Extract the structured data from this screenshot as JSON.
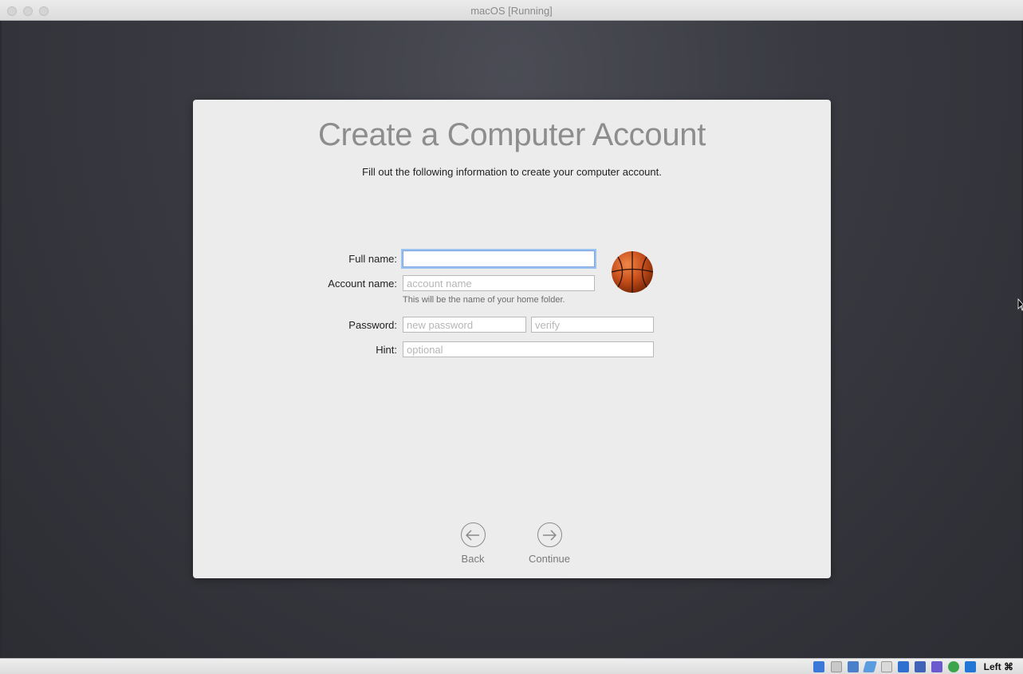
{
  "window": {
    "title": "macOS [Running]"
  },
  "setup": {
    "heading": "Create a Computer Account",
    "subheading": "Fill out the following information to create your computer account.",
    "full_name": {
      "label": "Full name:",
      "value": "",
      "placeholder": ""
    },
    "account_name": {
      "label": "Account name:",
      "value": "",
      "placeholder": "account name",
      "helper": "This will be the name of your home folder."
    },
    "password": {
      "label": "Password:",
      "placeholder": "new password",
      "verify_placeholder": "verify"
    },
    "hint": {
      "label": "Hint:",
      "placeholder": "optional"
    },
    "avatar": {
      "icon": "basketball-icon"
    },
    "back_label": "Back",
    "continue_label": "Continue"
  },
  "statusbar": {
    "icons": [
      "hard-disk-icon",
      "optical-drive-icon",
      "network-icon",
      "usb-icon",
      "shared-folder-icon",
      "display-icon",
      "screen-capture-icon",
      "vm-icon",
      "network-activity-icon",
      "download-icon"
    ],
    "host_key": "Left ⌘"
  },
  "colors": {
    "focus_ring": "#9cc2f2",
    "panel": "#ececec",
    "desktop": "#2c2d33"
  }
}
